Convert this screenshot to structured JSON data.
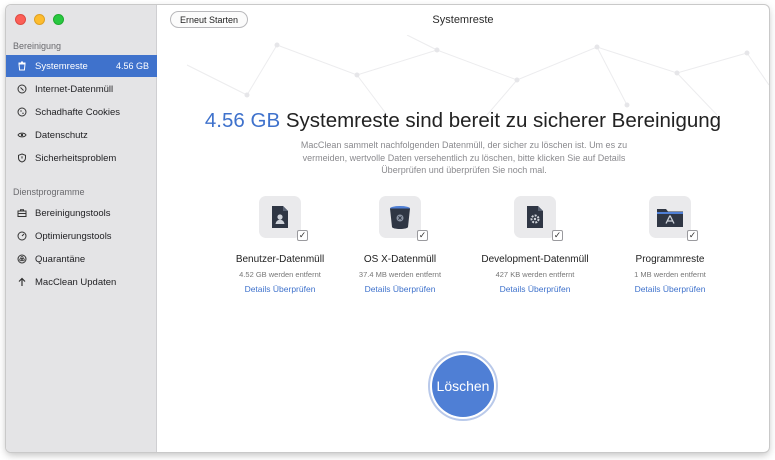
{
  "sidebar": {
    "section_cleaning": "Bereinigung",
    "cleaning_items": [
      {
        "label": "Systemreste",
        "badge": "4.56 GB",
        "icon": "trash-icon"
      },
      {
        "label": "Internet-Datenmüll",
        "icon": "globe-icon"
      },
      {
        "label": "Schadhafte Cookies",
        "icon": "cookie-icon"
      },
      {
        "label": "Datenschutz",
        "icon": "eye-icon"
      },
      {
        "label": "Sicherheitsproblem",
        "icon": "shield-icon"
      }
    ],
    "section_utilities": "Dienstprogramme",
    "utility_items": [
      {
        "label": "Bereinigungstools",
        "icon": "toolbox-icon"
      },
      {
        "label": "Optimierungstools",
        "icon": "gauge-icon"
      },
      {
        "label": "Quarantäne",
        "icon": "biohazard-icon"
      },
      {
        "label": "MacClean Updaten",
        "icon": "upload-arrow-icon"
      }
    ]
  },
  "titlebar": {
    "title": "Systemreste",
    "restart_label": "Erneut Starten"
  },
  "main": {
    "headline_size": "4.56 GB",
    "headline_text": " Systemreste sind bereit zu sicherer Bereinigung",
    "description": "MacClean sammelt nachfolgenden Datenmüll, der sicher zu löschen ist. Um es zu vermeiden, wertvolle Daten versehentlich zu löschen, bitte klicken Sie auf Details Überprüfen und überprüfen Sie noch mal.",
    "categories": [
      {
        "name": "Benutzer-Datenmüll",
        "sub": "4.52 GB werden entfernt",
        "link": "Details Überprüfen",
        "icon": "user-document-icon",
        "checked": true
      },
      {
        "name": "OS X-Datenmüll",
        "sub": "37.4 MB werden entfernt",
        "link": "Details Überprüfen",
        "icon": "trash-bin-icon",
        "checked": true
      },
      {
        "name": "Development-Datenmüll",
        "sub": "427 KB werden entfernt",
        "link": "Details Überprüfen",
        "icon": "gear-document-icon",
        "checked": true
      },
      {
        "name": "Programmreste",
        "sub": "1 MB werden entfernt",
        "link": "Details Überprüfen",
        "icon": "apps-folder-icon",
        "checked": true
      }
    ],
    "delete_label": "Löschen"
  },
  "colors": {
    "accent": "#3f72cc",
    "sidebar_bg": "#e4e4e6",
    "icon_dark": "#2f3644"
  }
}
